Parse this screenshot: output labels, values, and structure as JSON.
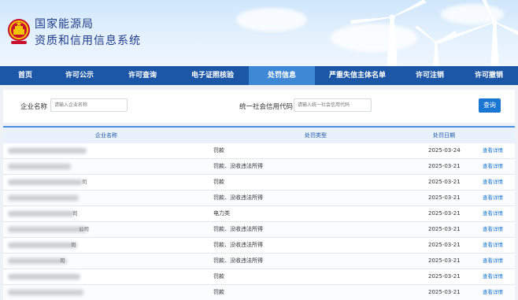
{
  "header": {
    "title_line1": "国家能源局",
    "title_line2": "资质和信用信息系统",
    "emblem_icon": "national-emblem-icon",
    "scenery_icon": "wind-turbine-icon"
  },
  "nav": {
    "items": [
      {
        "label": "首页",
        "active": false
      },
      {
        "label": "许可公示",
        "active": false
      },
      {
        "label": "许可查询",
        "active": false
      },
      {
        "label": "电子证照核验",
        "active": false
      },
      {
        "label": "处罚信息",
        "active": true
      },
      {
        "label": "严重失信主体名单",
        "active": false
      },
      {
        "label": "许可注销",
        "active": false
      },
      {
        "label": "许可撤销",
        "active": false
      }
    ]
  },
  "search": {
    "company_label": "企业名称",
    "company_placeholder": "请输入企业名称",
    "credit_label": "统一社会信用代码",
    "credit_placeholder": "请输入统一社会信用代码",
    "query_button": "查询"
  },
  "table": {
    "headers": {
      "name": "企业名称",
      "type": "处罚类型",
      "date": "处罚日期"
    },
    "rows": [
      {
        "name_tail": "",
        "type": "罚款",
        "date": "2025-03-24",
        "action": "查看详情"
      },
      {
        "name_tail": "",
        "type": "罚款、没收违法所得",
        "date": "2025-03-21",
        "action": "查看详情"
      },
      {
        "name_tail": "司",
        "type": "罚款",
        "date": "2025-03-21",
        "action": "查看详情"
      },
      {
        "name_tail": "",
        "type": "罚款、没收违法所得",
        "date": "2025-03-21",
        "action": "查看详情"
      },
      {
        "name_tail": "司",
        "type": "电力类",
        "date": "2025-03-21",
        "action": "查看详情"
      },
      {
        "name_tail": "公司",
        "type": "罚款、没收违法所得",
        "date": "2025-03-21",
        "action": "查看详情"
      },
      {
        "name_tail": "司",
        "type": "罚款、没收违法所得",
        "date": "2025-03-21",
        "action": "查看详情"
      },
      {
        "name_tail": "司",
        "type": "罚款、没收违法所得",
        "date": "2025-03-21",
        "action": "查看详情"
      },
      {
        "name_tail": "",
        "type": "罚款",
        "date": "2025-03-21",
        "action": "查看详情"
      },
      {
        "name_tail": "",
        "type": "罚款",
        "date": "2025-03-21",
        "action": "查看详情"
      }
    ]
  },
  "colors": {
    "nav_bg": "#1b56a7",
    "nav_active": "#3f88d6",
    "accent": "#1976d2",
    "title": "#1f3c8a"
  }
}
